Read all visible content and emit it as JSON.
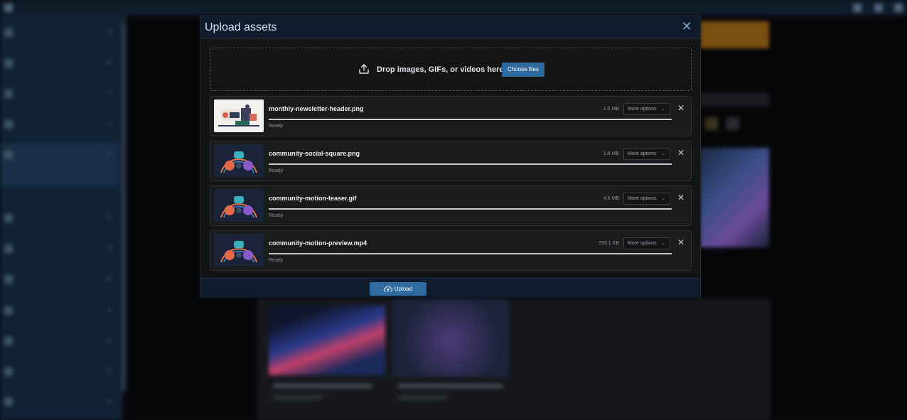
{
  "modal": {
    "title": "Upload assets",
    "close_icon": "close-icon",
    "dropzone": {
      "text": "Drop images, GIFs, or videos here",
      "icon": "upload-icon",
      "choose_label": "Choose files"
    },
    "files": [
      {
        "name": "monthly-newsletter-header.png",
        "size": "1.5 MB",
        "options_label": "More options",
        "status": "Ready",
        "progress": 1.0
      },
      {
        "name": "community-social-square.png",
        "size": "1.8 MB",
        "options_label": "More options",
        "status": "Ready",
        "progress": 1.0
      },
      {
        "name": "community-motion-teaser.gif",
        "size": "4.6 MB",
        "options_label": "More options",
        "status": "Ready",
        "progress": 1.0
      },
      {
        "name": "community-motion-preview.mp4",
        "size": "293.1 KB",
        "options_label": "More options",
        "status": "Ready",
        "progress": 1.0
      }
    ],
    "upload_label": "Upload"
  },
  "colors": {
    "primary_button": "#2f6aa0",
    "header_bg": "#0f1b2a",
    "modal_bg": "#131416"
  }
}
